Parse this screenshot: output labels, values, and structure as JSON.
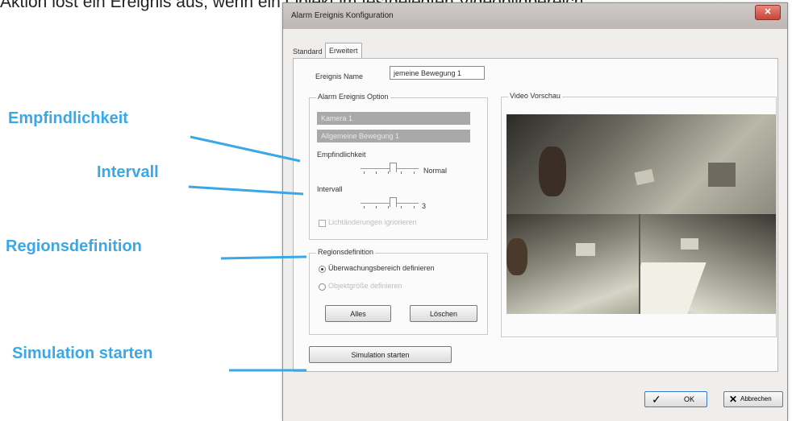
{
  "header_text": "Aktion löst ein Ereignis aus, wenn ein Objekt im festgelegten Videobildbereich",
  "callouts": {
    "sensitivity": "Empfindlichkeit",
    "interval": "Intervall",
    "region": "Regionsdefinition",
    "simulation": "Simulation starten"
  },
  "colors": {
    "callout": "#3aa8e6",
    "dialog_bg": "#f0eded",
    "close_button": "#c8453a"
  },
  "dialog": {
    "title": "Alarm Ereignis Konfiguration",
    "close_icon": "close-icon",
    "tabs": [
      {
        "label": "Standard",
        "active": false
      },
      {
        "label": "Erweitert",
        "active": true
      }
    ],
    "event_name_label": "Ereignis Name",
    "event_name_value": "jemeine Bewegung 1",
    "alarm_option": {
      "title": "Alarm Ereignis Option",
      "camera": "Kamera 1",
      "event_type": "Allgemeine Bewegung 1",
      "sensitivity_label": "Empfindlichkeit",
      "sensitivity_value": "Normal",
      "sensitivity_position": 0.55,
      "interval_label": "Intervall",
      "interval_value": "3",
      "interval_position": 0.55,
      "ignore_light_label": "Lichtänderungen ignorieren",
      "ignore_light_checked": false
    },
    "region": {
      "title": "Regionsdefinition",
      "option_monitor": "Überwachungsbereich definieren",
      "option_monitor_selected": true,
      "option_object": "Objektgröße definieren",
      "option_object_selected": false,
      "all_button": "Alles",
      "delete_button": "Löschen"
    },
    "video_preview_title": "Video Vorschau",
    "simulation_button": "Simulation starten",
    "ok_button": "OK",
    "ok_icon": "checkmark-icon",
    "cancel_button": "Abbrechen",
    "cancel_icon": "x-icon"
  }
}
